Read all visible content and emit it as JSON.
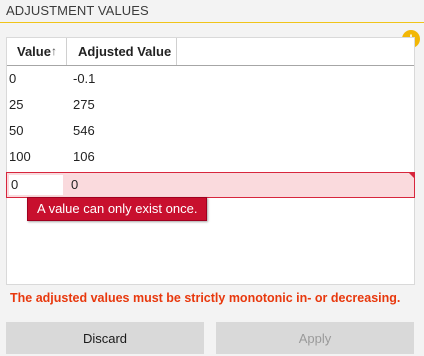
{
  "section": {
    "title": "ADJUSTMENT VALUES"
  },
  "warning_icon": {
    "glyph": "!",
    "color": "#f2b705"
  },
  "table": {
    "columns": [
      "Value",
      "Adjusted Value"
    ],
    "sort_indicator": "↑",
    "rows": [
      {
        "value": "0",
        "adjusted": "-0.1"
      },
      {
        "value": "25",
        "adjusted": "275"
      },
      {
        "value": "50",
        "adjusted": "546"
      },
      {
        "value": "100",
        "adjusted": "106"
      }
    ],
    "edit_row": {
      "value": "0",
      "adjusted": "0"
    }
  },
  "tooltip": "A value can only exist once.",
  "error_message": "The adjusted values must be strictly monotonic in- or decreasing.",
  "buttons": {
    "discard": "Discard",
    "apply": "Apply"
  },
  "colors": {
    "accent": "#f0c419",
    "error": "#d7263d",
    "error_text": "#e8380d"
  }
}
